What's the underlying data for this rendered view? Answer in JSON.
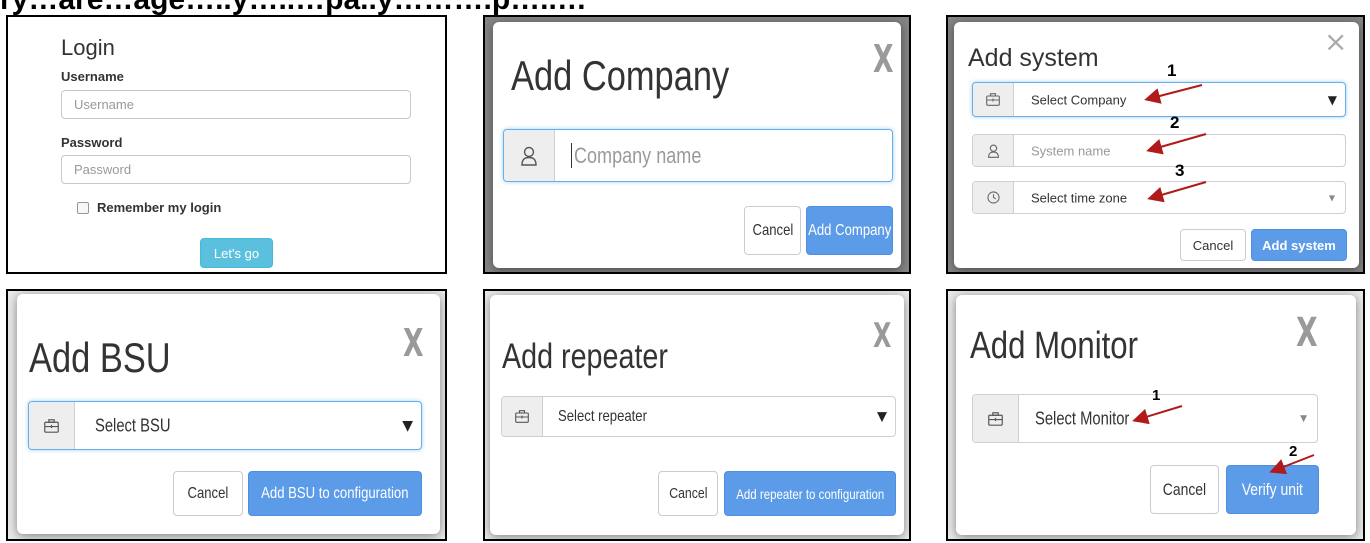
{
  "caption": "ry…are…age…..y…..…pa..y……….p…..…",
  "login": {
    "title": "Login",
    "username_label": "Username",
    "username_placeholder": "Username",
    "password_label": "Password",
    "password_placeholder": "Password",
    "remember_label": "Remember my login",
    "submit_label": "Let's go"
  },
  "add_company": {
    "title": "Add Company",
    "close": "X",
    "input_placeholder": "Company name",
    "cancel_label": "Cancel",
    "submit_label": "Add Company"
  },
  "add_system": {
    "title": "Add system",
    "close": "×",
    "company_select": "Select Company",
    "system_placeholder": "System name",
    "timezone_select": "Select time zone",
    "cancel_label": "Cancel",
    "submit_label": "Add system",
    "annotations": [
      "1",
      "2",
      "3"
    ]
  },
  "add_bsu": {
    "title": "Add BSU",
    "close": "X",
    "select": "Select BSU",
    "cancel_label": "Cancel",
    "submit_label": "Add BSU to configuration"
  },
  "add_repeater": {
    "title": "Add repeater",
    "close": "X",
    "select": "Select repeater",
    "cancel_label": "Cancel",
    "submit_label": "Add repeater to configuration"
  },
  "add_monitor": {
    "title": "Add Monitor",
    "close": "X",
    "select": "Select Monitor",
    "cancel_label": "Cancel",
    "submit_label": "Verify unit",
    "annotations": [
      "1",
      "2"
    ]
  },
  "colors": {
    "primary": "#5b9be8",
    "login_button": "#5bc0de",
    "annotation_arrow": "#b01a1a",
    "overlay": "#858585"
  },
  "icons": {
    "briefcase": "briefcase-icon",
    "user": "user-icon",
    "clock": "clock-icon",
    "close": "close-icon",
    "dropdown": "chevron-down-icon"
  }
}
